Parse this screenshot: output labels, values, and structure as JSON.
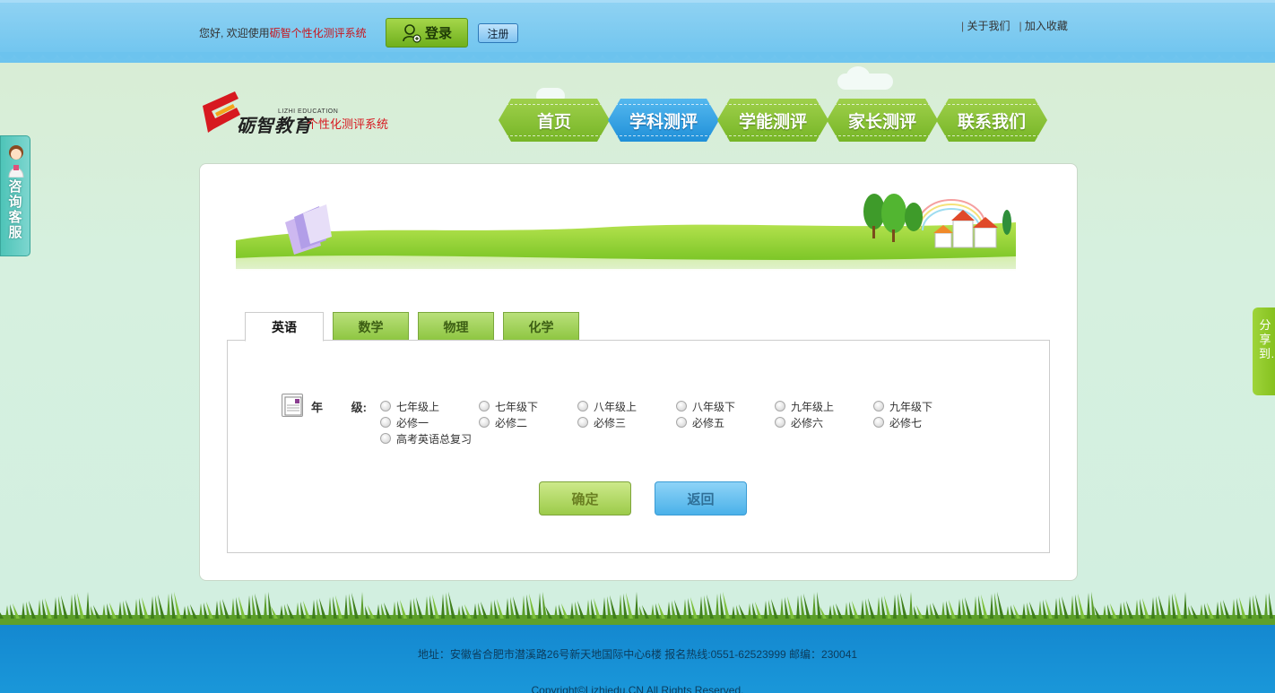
{
  "header": {
    "greeting_prefix": "您好, 欢迎使用",
    "system_name": "砺智个性化测评系统",
    "login_label": "登录",
    "register_label": "注册",
    "links": [
      "关于我们",
      "加入收藏"
    ]
  },
  "logo": {
    "brand": "砺智教育",
    "english": "LIZHI EDUCATION",
    "subtitle": "个性化测评系统"
  },
  "nav": {
    "items": [
      "首页",
      "学科测评",
      "学能测评",
      "家长测评",
      "联系我们"
    ],
    "active": "学科测评"
  },
  "subject_tabs": {
    "items": [
      "英语",
      "数学",
      "物理",
      "化学"
    ],
    "active": "英语"
  },
  "grade": {
    "label_left": "年",
    "label_right": "级:",
    "options": [
      "七年级上",
      "七年级下",
      "八年级上",
      "八年级下",
      "九年级上",
      "九年级下",
      "必修一",
      "必修二",
      "必修三",
      "必修五",
      "必修六",
      "必修七",
      "高考英语总复习"
    ]
  },
  "buttons": {
    "confirm": "确定",
    "back": "返回"
  },
  "side": {
    "consult": "咨询客服",
    "share": "分享到…"
  },
  "footer": {
    "address": "地址：安徽省合肥市潜溪路26号新天地国际中心6楼 报名热线:0551-62523999 邮编：230041",
    "copyright": "Copyright©Lizhiedu.CN All Rights Reserved."
  },
  "colors": {
    "nav_green": "#86c22f",
    "nav_active_blue": "#2f9be0",
    "footer_blue": "#1a8fd4",
    "system_name_red": "#c8151d"
  }
}
